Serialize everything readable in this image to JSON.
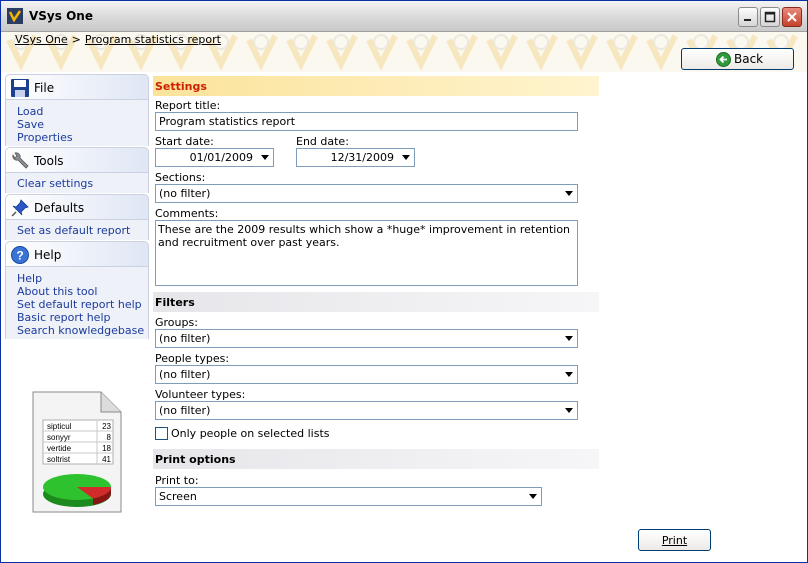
{
  "window": {
    "title": "VSys One"
  },
  "breadcrumb": {
    "home": "VSys One",
    "separator": ">",
    "current": "Program statistics report"
  },
  "back_button": {
    "label": "Back"
  },
  "sidebar": {
    "file": {
      "label": "File",
      "items": [
        "Load",
        "Save",
        "Properties"
      ]
    },
    "tools": {
      "label": "Tools",
      "items": [
        "Clear settings"
      ]
    },
    "defaults": {
      "label": "Defaults",
      "items": [
        "Set as default report"
      ]
    },
    "help": {
      "label": "Help",
      "items": [
        "Help",
        "About this tool",
        "Set default report help",
        "Basic report help",
        "Search knowledgebase"
      ]
    }
  },
  "report_graphic": {
    "rows": [
      [
        "sipticul",
        "23"
      ],
      [
        "sonyyr",
        "8"
      ],
      [
        "vertide",
        "18"
      ],
      [
        "soltrist",
        "41"
      ]
    ]
  },
  "settings": {
    "heading": "Settings",
    "report_title_label": "Report title:",
    "report_title_value": "Program statistics report",
    "start_date_label": "Start date:",
    "start_date_value": "01/01/2009",
    "end_date_label": "End date:",
    "end_date_value": "12/31/2009",
    "sections_label": "Sections:",
    "sections_value": "(no filter)",
    "comments_label": "Comments:",
    "comments_value": "These are the 2009 results which show a *huge* improvement in retention and recruitment over past years."
  },
  "filters": {
    "heading": "Filters",
    "groups_label": "Groups:",
    "groups_value": "(no filter)",
    "people_types_label": "People types:",
    "people_types_value": "(no filter)",
    "volunteer_types_label": "Volunteer types:",
    "volunteer_types_value": "(no filter)",
    "only_selected_label": "Only people on selected lists",
    "only_selected_checked": false
  },
  "print_options": {
    "heading": "Print options",
    "print_to_label": "Print to:",
    "print_to_value": "Screen"
  },
  "print_button": {
    "label": "Print"
  },
  "colors": {
    "accent_orange": "#cc2200",
    "link_blue": "#1b3b9c",
    "brand_band": "#fbf8ef"
  }
}
